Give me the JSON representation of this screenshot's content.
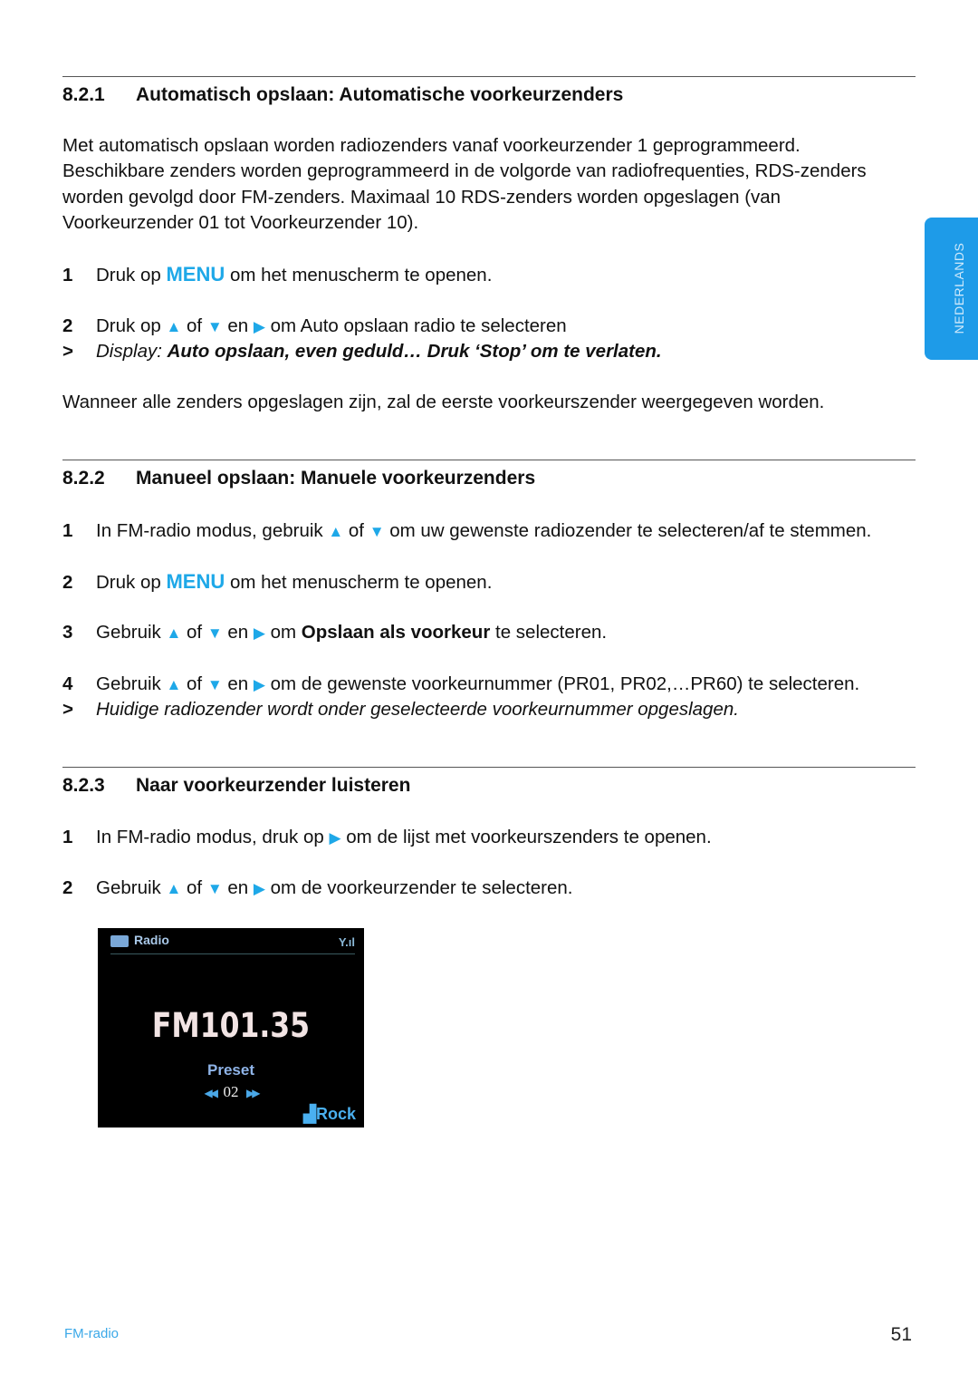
{
  "side_tab": {
    "label": "NEDERLANDS"
  },
  "sections": [
    {
      "number": "8.2.1",
      "title": "Automatisch opslaan: Automatische voorkeurzenders",
      "paragraph": "Met automatisch opslaan worden radiozenders vanaf voorkeurzender 1 geprogrammeerd. Beschikbare zenders worden geprogrammeerd in de volgorde van radiofrequenties, RDS-zenders worden gevolgd door FM-zenders. Maximaal 10 RDS-zenders worden opgeslagen (van Voorkeurzender 01 tot Voorkeurzender 10).",
      "lines": [
        {
          "n": "1",
          "parts": [
            [
              "t",
              "Druk op "
            ],
            [
              "m",
              "MENU"
            ],
            [
              "t",
              " om het menuscherm te openen."
            ]
          ]
        },
        {
          "n": "2",
          "parts": [
            [
              "t",
              "Druk op "
            ],
            [
              "up",
              "▲"
            ],
            [
              "t",
              " of "
            ],
            [
              "down",
              "▼"
            ],
            [
              "t",
              " en "
            ],
            [
              "right",
              "▶"
            ],
            [
              "t",
              " om Auto opslaan radio te selecteren"
            ]
          ]
        },
        {
          "n": ">",
          "parts": [
            [
              "i",
              "Display: "
            ],
            [
              "bi",
              "Auto opslaan, even geduld… Druk ‘Stop’ om te verlaten."
            ]
          ]
        }
      ],
      "closing": "Wanneer alle zenders opgeslagen zijn, zal de eerste voorkeurszender weergegeven worden."
    },
    {
      "number": "8.2.2",
      "title": "Manueel opslaan: Manuele voorkeurzenders",
      "lines": [
        {
          "n": "1",
          "parts": [
            [
              "t",
              "In FM-radio modus, gebruik "
            ],
            [
              "up",
              "▲"
            ],
            [
              "t",
              " of "
            ],
            [
              "down",
              "▼"
            ],
            [
              "t",
              " om uw gewenste radiozender te selecteren/af te stemmen."
            ]
          ]
        },
        {
          "n": "2",
          "parts": [
            [
              "t",
              "Druk op "
            ],
            [
              "m",
              "MENU"
            ],
            [
              "t",
              " om het menuscherm te openen."
            ]
          ]
        },
        {
          "n": "3",
          "parts": [
            [
              "t",
              "Gebruik "
            ],
            [
              "up",
              "▲"
            ],
            [
              "t",
              " of "
            ],
            [
              "down",
              "▼"
            ],
            [
              "t",
              " en "
            ],
            [
              "right",
              "▶"
            ],
            [
              "t",
              " om "
            ],
            [
              "b",
              "Opslaan als voorkeur"
            ],
            [
              "t",
              " te selecteren."
            ]
          ]
        },
        {
          "n": "4",
          "parts": [
            [
              "t",
              "Gebruik "
            ],
            [
              "up",
              "▲"
            ],
            [
              "t",
              " of "
            ],
            [
              "down",
              "▼"
            ],
            [
              "t",
              " en "
            ],
            [
              "right",
              "▶"
            ],
            [
              "t",
              " om de gewenste voorkeurnummer (PR01, PR02,…PR60) te selecteren."
            ]
          ]
        },
        {
          "n": ">",
          "parts": [
            [
              "i",
              "Huidige radiozender wordt onder geselecteerde voorkeurnummer opgeslagen."
            ]
          ]
        }
      ]
    },
    {
      "number": "8.2.3",
      "title": "Naar voorkeurzender luisteren",
      "lines": [
        {
          "n": "1",
          "parts": [
            [
              "t",
              "In FM-radio modus, druk op "
            ],
            [
              "right",
              "▶"
            ],
            [
              "t",
              " om de lijst met voorkeurszenders te openen."
            ]
          ]
        },
        {
          "n": "2",
          "parts": [
            [
              "t",
              "Gebruik "
            ],
            [
              "up",
              "▲"
            ],
            [
              "t",
              " of "
            ],
            [
              "down",
              "▼"
            ],
            [
              "t",
              " en "
            ],
            [
              "right",
              "▶"
            ],
            [
              "t",
              " om de voorkeurzender te selecteren."
            ]
          ]
        }
      ]
    }
  ],
  "screen": {
    "title": "Radio",
    "frequency": "FM101.35",
    "preset_label": "Preset",
    "preset_number": "02",
    "genre": "Rock",
    "prev_icon": "⏮",
    "next_icon": "⏭"
  },
  "footer": {
    "section": "FM-radio",
    "page": "51"
  },
  "colors": {
    "accent": "#1ea8e8",
    "tab": "#1e9be8"
  }
}
